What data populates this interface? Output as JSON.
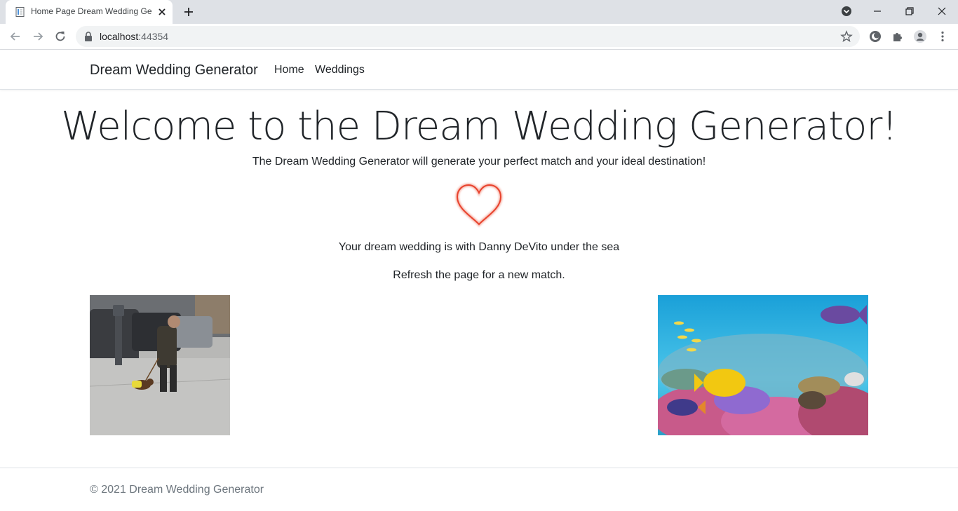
{
  "browser": {
    "tab_title": "Home Page Dream Wedding Generator",
    "url_host": "localhost",
    "url_port": ":44354"
  },
  "site": {
    "brand": "Dream Wedding Generator",
    "nav": [
      "Home",
      "Weddings"
    ]
  },
  "main": {
    "heading": "Welcome to the Dream Wedding Generator!",
    "lead": "The Dream Wedding Generator will generate your perfect match and your ideal destination!",
    "result": "Your dream wedding is with Danny DeVito under the sea",
    "refresh": "Refresh the page for a new match.",
    "match_image": "street photo of man walking a dachshund",
    "destination_image": "coral reef with tropical fish"
  },
  "footer": {
    "text": "© 2021 Dream Wedding Generator"
  },
  "colors": {
    "heart": "#e8432e",
    "tabstrip": "#dee1e6",
    "footer_text": "#6c757d"
  }
}
